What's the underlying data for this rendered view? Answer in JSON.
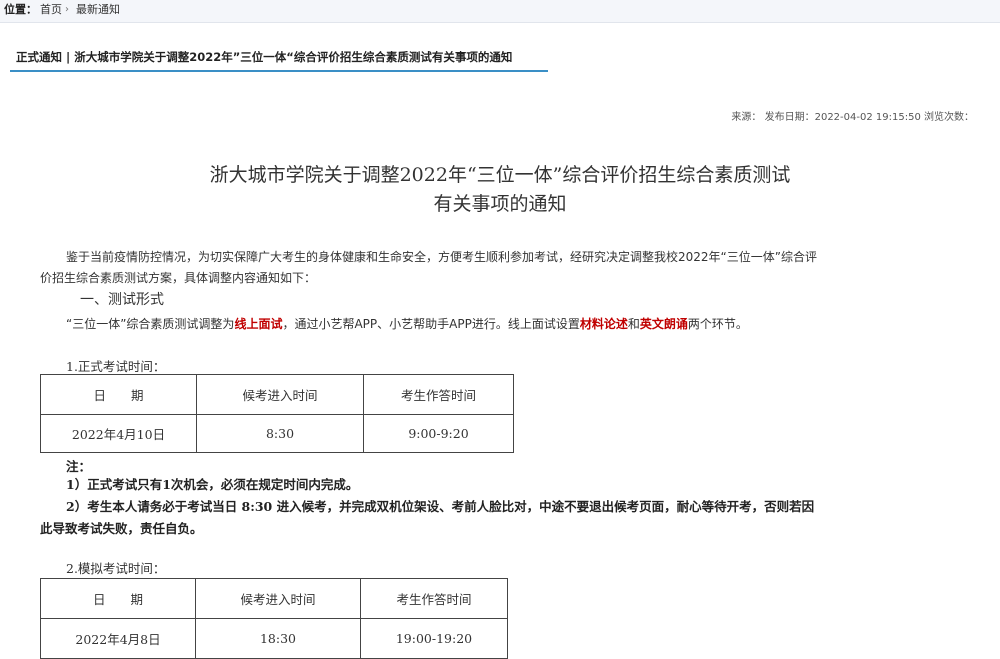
{
  "breadcrumb": {
    "label": "位置：",
    "home": "首页",
    "current": "最新通知"
  },
  "section": {
    "title": "正式通知 | 浙大城市学院关于调整2022年”三位一体“综合评价招生综合素质测试有关事项的通知"
  },
  "meta": {
    "text": "来源： 发布日期：2022-04-02 19:15:50 浏览次数："
  },
  "article": {
    "title_line1": "浙大城市学院关于调整2022年“三位一体”综合评价招生综合素质测试",
    "title_line2": "有关事项的通知",
    "intro_line1": "鉴于当前疫情防控情况，为切实保障广大考生的身体健康和生命安全，方便考生顺利参加考试，经研究决定调整我校2022年“三位一体”综合评",
    "intro_line2": "价招生综合素质测试方案，具体调整内容通知如下：",
    "heading1": "一、测试形式",
    "form_a": "“三位一体”综合素质测试调整为",
    "form_hl1": "线上面试",
    "form_b": "，通过小艺帮APP、小艺帮助手APP进行。线上面试设置",
    "form_hl2": "材料论述",
    "form_c": "和",
    "form_hl3": "英文朗诵",
    "form_d": "两个环节。",
    "formal_label": "1.正式考试时间：",
    "formal_table": {
      "headers": [
        "日　　期",
        "候考进入时间",
        "考生作答时间"
      ],
      "row": [
        "2022年4月10日",
        "8:30",
        "9:00-9:20"
      ]
    },
    "note_label": "注：",
    "note1": "1）正式考试只有1次机会，必须在规定时间内完成。",
    "note2_line1": "2）考生本人请务必于考试当日 8:30 进入候考，并完成双机位架设、考前人脸比对，中途不要退出候考页面，耐心等待开考，否则若因",
    "note2_line2": "此导致考试失败，责任自负。",
    "mock_label": "2.模拟考试时间：",
    "mock_table": {
      "headers": [
        "日　　期",
        "候考进入时间",
        "考生作答时间"
      ],
      "row": [
        "2022年4月8日",
        "18:30",
        "19:00-19:20"
      ]
    }
  },
  "colors": {
    "accent": "#3a8fc6",
    "highlight": "#c00000"
  }
}
